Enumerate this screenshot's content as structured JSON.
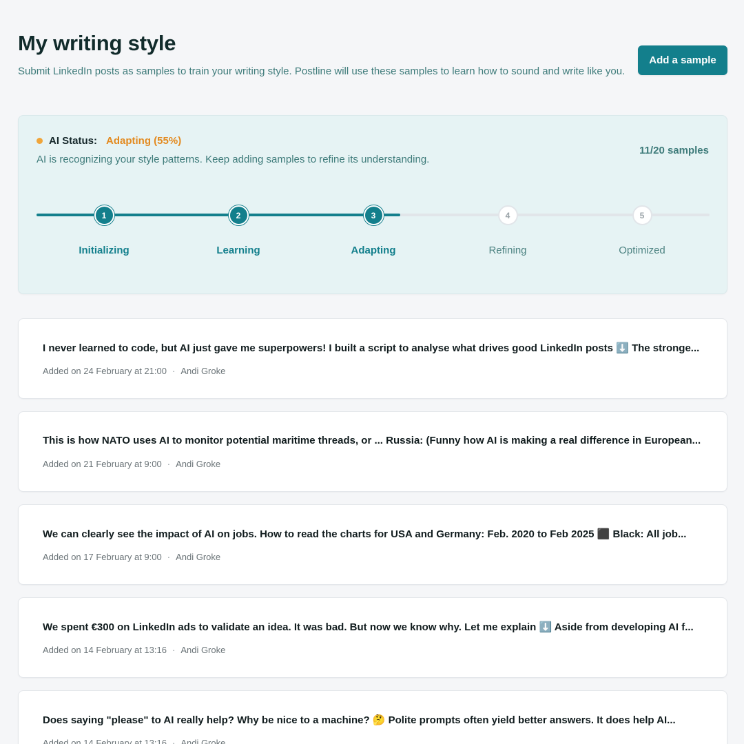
{
  "header": {
    "title": "My writing style",
    "subtitle": "Submit LinkedIn posts as samples to train your writing style. Postline will use these samples to learn how to sound and write like you.",
    "add_button": "Add a sample"
  },
  "ai_status": {
    "label": "AI Status:",
    "value": "Adapting (55%)",
    "progress_percent": 55,
    "description": "AI is recognizing your style patterns. Keep adding samples to refine its understanding.",
    "samples_count": "11/20 samples",
    "current_step": 3,
    "steps": [
      {
        "number": "1",
        "label": "Initializing"
      },
      {
        "number": "2",
        "label": "Learning"
      },
      {
        "number": "3",
        "label": "Adapting"
      },
      {
        "number": "4",
        "label": "Refining"
      },
      {
        "number": "5",
        "label": "Optimized"
      }
    ]
  },
  "samples": [
    {
      "text": "I never learned to code, but AI just gave me superpowers! I built a script to analyse what drives good LinkedIn posts ⬇️ The stronge...",
      "added": "Added on 24 February at 21:00",
      "separator": "·",
      "author": "Andi Groke"
    },
    {
      "text": "This is how NATO uses AI to monitor potential maritime threads, or ... Russia: (Funny how AI is making a real difference in European...",
      "added": "Added on 21 February at 9:00",
      "separator": "·",
      "author": "Andi Groke"
    },
    {
      "text": "We can clearly see the impact of AI on jobs. How to read the charts for USA and Germany: Feb. 2020 to Feb 2025 ⬛ Black: All job...",
      "added": "Added on 17 February at 9:00",
      "separator": "·",
      "author": "Andi Groke"
    },
    {
      "text": "We spent €300 on LinkedIn ads to validate an idea. It was bad. But now we know why. Let me explain ⬇️ Aside from developing AI f...",
      "added": "Added on 14 February at 13:16",
      "separator": "·",
      "author": "Andi Groke"
    },
    {
      "text": "Does saying \"please\" to AI really help? Why be nice to a machine? 🤔 Polite prompts often yield better answers. It does help AI...",
      "added": "Added on 14 February at 13:16",
      "separator": "·",
      "author": "Andi Groke"
    }
  ],
  "colors": {
    "accent": "#137f8c",
    "status_warning": "#e38a1f",
    "status_card_bg": "#e6f3f4",
    "page_bg": "#f5f6f8"
  }
}
